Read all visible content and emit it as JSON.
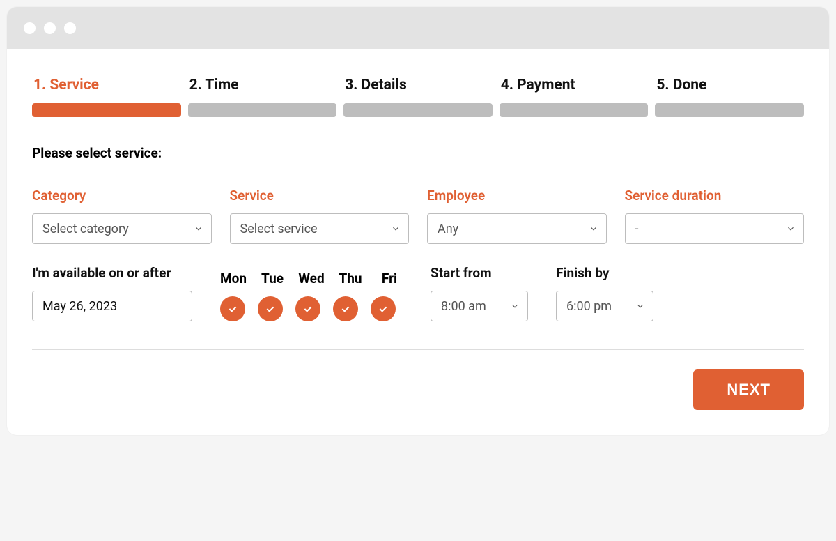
{
  "colors": {
    "accent": "#e06033",
    "bar_inactive": "#bdbdbd"
  },
  "steps": [
    {
      "label": "1. Service",
      "active": true
    },
    {
      "label": "2. Time",
      "active": false
    },
    {
      "label": "3. Details",
      "active": false
    },
    {
      "label": "4. Payment",
      "active": false
    },
    {
      "label": "5. Done",
      "active": false
    }
  ],
  "heading": "Please select service:",
  "fields": {
    "category": {
      "label": "Category",
      "value": "Select category"
    },
    "service": {
      "label": "Service",
      "value": "Select service"
    },
    "employee": {
      "label": "Employee",
      "value": "Any"
    },
    "duration": {
      "label": "Service duration",
      "value": "-"
    }
  },
  "availability": {
    "date_label": "I'm available on or after",
    "date_value": "May 26, 2023",
    "days": [
      "Mon",
      "Tue",
      "Wed",
      "Thu",
      "Fri"
    ],
    "days_selected": [
      true,
      true,
      true,
      true,
      true
    ],
    "start_label": "Start from",
    "start_value": "8:00 am",
    "finish_label": "Finish by",
    "finish_value": "6:00 pm"
  },
  "next_button": "NEXT"
}
